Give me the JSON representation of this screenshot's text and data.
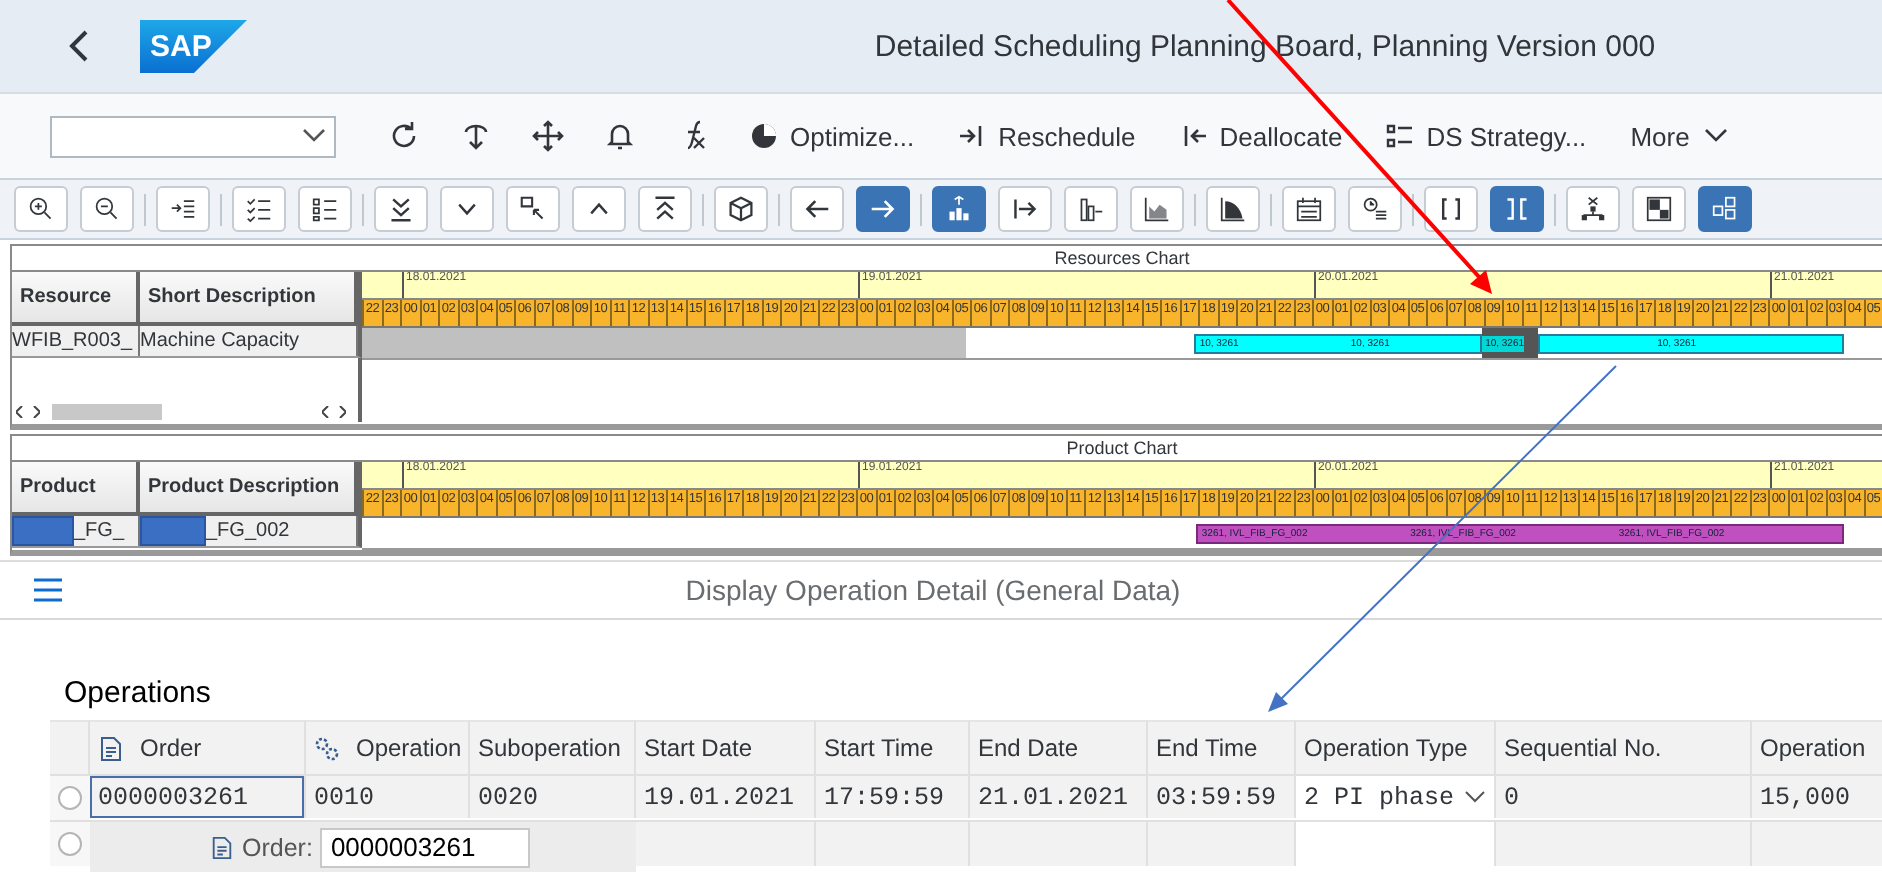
{
  "header": {
    "logo": "SAP",
    "title": "Detailed Scheduling Planning Board, Planning Version 000"
  },
  "toolbar": {
    "icons": [
      {
        "kind": "refresh"
      },
      {
        "kind": "pin"
      },
      {
        "kind": "move"
      },
      {
        "kind": "bell"
      },
      {
        "kind": "formula"
      }
    ],
    "actions": [
      {
        "kind": "optimize",
        "label": "Optimize..."
      },
      {
        "kind": "reschedule",
        "label": "Reschedule"
      },
      {
        "kind": "deallocate",
        "label": "Deallocate"
      },
      {
        "kind": "strategy",
        "label": "DS Strategy..."
      },
      {
        "kind": "more",
        "label": "More"
      }
    ]
  },
  "icon_toolbar": {
    "groups": [
      {
        "buttons": [
          {
            "kind": "zoom-in",
            "selected": false
          },
          {
            "kind": "zoom-out",
            "selected": false
          }
        ]
      },
      {
        "buttons": [
          {
            "kind": "indent",
            "selected": false
          }
        ]
      },
      {
        "buttons": [
          {
            "kind": "checklist",
            "selected": false
          },
          {
            "kind": "list",
            "selected": false
          }
        ]
      },
      {
        "buttons": [
          {
            "kind": "double-down",
            "selected": false
          },
          {
            "kind": "down",
            "selected": false
          },
          {
            "kind": "corner",
            "selected": false
          },
          {
            "kind": "up",
            "selected": false
          },
          {
            "kind": "double-up",
            "selected": false
          }
        ]
      },
      {
        "buttons": [
          {
            "kind": "cube",
            "selected": false
          }
        ]
      },
      {
        "buttons": [
          {
            "kind": "left",
            "selected": false
          },
          {
            "kind": "right",
            "selected": true
          }
        ]
      },
      {
        "buttons": [
          {
            "kind": "hierarchy",
            "selected": true
          },
          {
            "kind": "arrow-bar",
            "selected": false
          },
          {
            "kind": "bar-chart",
            "selected": false
          },
          {
            "kind": "area-chart",
            "selected": false
          }
        ]
      },
      {
        "buttons": [
          {
            "kind": "curve",
            "selected": false
          }
        ]
      },
      {
        "buttons": [
          {
            "kind": "calendar",
            "selected": false
          },
          {
            "kind": "clock-list",
            "selected": false
          }
        ]
      },
      {
        "buttons": [
          {
            "kind": "brackets",
            "selected": false
          },
          {
            "kind": "reverse-brackets",
            "selected": true
          }
        ]
      },
      {
        "buttons": [
          {
            "kind": "tree",
            "selected": false
          },
          {
            "kind": "squares",
            "selected": false
          },
          {
            "kind": "grid",
            "selected": true
          }
        ]
      }
    ]
  },
  "resources_chart": {
    "title": "Resources Chart",
    "columns": [
      "Resource",
      "Short Description"
    ],
    "days": [
      {
        "hours": [
          {
            "label": "22",
            "kind": "idle"
          },
          {
            "label": "23",
            "kind": "idle"
          }
        ]
      },
      {
        "date": "18.01.2021",
        "hours": [
          {
            "label": "00",
            "kind": "idle"
          },
          {
            "label": "01",
            "kind": "idle"
          },
          {
            "label": "02",
            "kind": "idle"
          },
          {
            "label": "03",
            "kind": "idle"
          },
          {
            "label": "04",
            "kind": "idle"
          },
          {
            "label": "05",
            "kind": "idle"
          },
          {
            "label": "06",
            "kind": "idle"
          },
          {
            "label": "07",
            "kind": "idle"
          },
          {
            "label": "08",
            "kind": "idle"
          },
          {
            "label": "09",
            "kind": "idle"
          },
          {
            "label": "10",
            "kind": "idle"
          },
          {
            "label": "11",
            "kind": "idle"
          },
          {
            "label": "12",
            "kind": "idle"
          },
          {
            "label": "13",
            "kind": "idle"
          },
          {
            "label": "14",
            "kind": "idle"
          },
          {
            "label": "15",
            "kind": "idle"
          },
          {
            "label": "16",
            "kind": "idle"
          },
          {
            "label": "17",
            "kind": "idle"
          },
          {
            "label": "18",
            "kind": "idle"
          },
          {
            "label": "19",
            "kind": "idle"
          },
          {
            "label": "20",
            "kind": "idle"
          },
          {
            "label": "21",
            "kind": "idle"
          },
          {
            "label": "22",
            "kind": "idle"
          },
          {
            "label": "23",
            "kind": "idle"
          }
        ]
      },
      {
        "date": "19.01.2021",
        "hours": [
          {
            "label": "00",
            "kind": "idle"
          },
          {
            "label": "01",
            "kind": "idle"
          },
          {
            "label": "02",
            "kind": "idle"
          },
          {
            "label": "03",
            "kind": "idle"
          },
          {
            "label": "04",
            "kind": "idle"
          },
          {
            "label": "05",
            "kind": "idle"
          },
          {
            "label": "06"
          },
          {
            "label": "07"
          },
          {
            "label": "08"
          },
          {
            "label": "09"
          },
          {
            "label": "10"
          },
          {
            "label": "11"
          },
          {
            "label": "12"
          },
          {
            "label": "13"
          },
          {
            "label": "14"
          },
          {
            "label": "15"
          },
          {
            "label": "16"
          },
          {
            "label": "17"
          },
          {
            "label": "18",
            "kind": "operation",
            "bar_label": "10, 3261"
          },
          {
            "label": "19",
            "kind": "operation"
          },
          {
            "label": "20",
            "kind": "operation"
          },
          {
            "label": "21",
            "kind": "operation"
          },
          {
            "label": "22",
            "kind": "operation"
          },
          {
            "label": "23",
            "kind": "operation"
          }
        ]
      },
      {
        "date": "20.01.2021",
        "hours": [
          {
            "label": "00",
            "kind": "operation"
          },
          {
            "label": "01",
            "kind": "operation"
          },
          {
            "label": "02",
            "kind": "operation",
            "bar_label": "10, 3261"
          },
          {
            "label": "03",
            "kind": "operation"
          },
          {
            "label": "04",
            "kind": "operation"
          },
          {
            "label": "05",
            "kind": "operation"
          },
          {
            "label": "06",
            "kind": "operation"
          },
          {
            "label": "07",
            "kind": "operation"
          },
          {
            "label": "08",
            "kind": "operation"
          },
          {
            "label": "09",
            "kind": "marker",
            "bar_label": "10, 3261"
          },
          {
            "label": "10",
            "kind": "marker"
          },
          {
            "label": "11",
            "kind": "marker"
          },
          {
            "label": "12",
            "kind": "operation"
          },
          {
            "label": "13",
            "kind": "operation"
          },
          {
            "label": "14",
            "kind": "operation"
          },
          {
            "label": "15",
            "kind": "operation"
          },
          {
            "label": "16",
            "kind": "operation"
          },
          {
            "label": "17",
            "kind": "operation"
          },
          {
            "label": "18",
            "kind": "operation",
            "bar_label": "10, 3261"
          },
          {
            "label": "19",
            "kind": "operation"
          },
          {
            "label": "20",
            "kind": "operation"
          },
          {
            "label": "21",
            "kind": "operation"
          },
          {
            "label": "22",
            "kind": "operation"
          },
          {
            "label": "23",
            "kind": "operation"
          }
        ]
      },
      {
        "date": "21.01.2021",
        "hours": [
          {
            "label": "00",
            "kind": "operation"
          },
          {
            "label": "01",
            "kind": "operation"
          },
          {
            "label": "02",
            "kind": "operation"
          },
          {
            "label": "03",
            "kind": "operation"
          },
          {
            "label": "04"
          },
          {
            "label": "05"
          }
        ]
      }
    ],
    "rows": [
      {
        "cells": [
          "WFIB_R003_",
          "Machine Capacity"
        ],
        "redacted": false
      }
    ],
    "scrollbar": true
  },
  "product_chart": {
    "title": "Product Chart",
    "columns": [
      "Product",
      "Product Description"
    ],
    "days": [
      {
        "hours": [
          {
            "label": "22"
          },
          {
            "label": "23"
          }
        ]
      },
      {
        "date": "18.01.2021",
        "hours": [
          {
            "label": "00"
          },
          {
            "label": "01"
          },
          {
            "label": "02"
          },
          {
            "label": "03"
          },
          {
            "label": "04"
          },
          {
            "label": "05"
          },
          {
            "label": "06"
          },
          {
            "label": "07"
          },
          {
            "label": "08"
          },
          {
            "label": "09"
          },
          {
            "label": "10"
          },
          {
            "label": "11"
          },
          {
            "label": "12"
          },
          {
            "label": "13"
          },
          {
            "label": "14"
          },
          {
            "label": "15"
          },
          {
            "label": "16"
          },
          {
            "label": "17"
          },
          {
            "label": "18"
          },
          {
            "label": "19"
          },
          {
            "label": "20"
          },
          {
            "label": "21"
          },
          {
            "label": "22"
          },
          {
            "label": "23"
          }
        ]
      },
      {
        "date": "19.01.2021",
        "hours": [
          {
            "label": "00"
          },
          {
            "label": "01"
          },
          {
            "label": "02"
          },
          {
            "label": "03"
          },
          {
            "label": "04"
          },
          {
            "label": "05"
          },
          {
            "label": "06"
          },
          {
            "label": "07"
          },
          {
            "label": "08"
          },
          {
            "label": "09"
          },
          {
            "label": "10"
          },
          {
            "label": "11"
          },
          {
            "label": "12"
          },
          {
            "label": "13"
          },
          {
            "label": "14"
          },
          {
            "label": "15"
          },
          {
            "label": "16"
          },
          {
            "label": "17"
          },
          {
            "label": "18",
            "kind": "product",
            "bar_label": "3261, IVL_FIB_FG_002"
          },
          {
            "label": "19",
            "kind": "product"
          },
          {
            "label": "20",
            "kind": "product"
          },
          {
            "label": "21",
            "kind": "product"
          },
          {
            "label": "22",
            "kind": "product"
          },
          {
            "label": "23",
            "kind": "product"
          }
        ]
      },
      {
        "date": "20.01.2021",
        "hours": [
          {
            "label": "00",
            "kind": "product"
          },
          {
            "label": "01",
            "kind": "product"
          },
          {
            "label": "02",
            "kind": "product"
          },
          {
            "label": "03",
            "kind": "product"
          },
          {
            "label": "04",
            "kind": "product"
          },
          {
            "label": "05",
            "kind": "product",
            "bar_label": "3261, IVL_FIB_FG_002"
          },
          {
            "label": "06",
            "kind": "product"
          },
          {
            "label": "07",
            "kind": "product"
          },
          {
            "label": "08",
            "kind": "product"
          },
          {
            "label": "09",
            "kind": "product"
          },
          {
            "label": "10",
            "kind": "product"
          },
          {
            "label": "11",
            "kind": "product"
          },
          {
            "label": "12",
            "kind": "product"
          },
          {
            "label": "13",
            "kind": "product"
          },
          {
            "label": "14",
            "kind": "product"
          },
          {
            "label": "15",
            "kind": "product"
          },
          {
            "label": "16",
            "kind": "product",
            "bar_label": "3261, IVL_FIB_FG_002"
          },
          {
            "label": "17",
            "kind": "product"
          },
          {
            "label": "18",
            "kind": "product"
          },
          {
            "label": "19",
            "kind": "product"
          },
          {
            "label": "20",
            "kind": "product"
          },
          {
            "label": "21",
            "kind": "product"
          },
          {
            "label": "22",
            "kind": "product"
          },
          {
            "label": "23",
            "kind": "product"
          }
        ]
      },
      {
        "date": "21.01.2021",
        "hours": [
          {
            "label": "00",
            "kind": "product"
          },
          {
            "label": "01",
            "kind": "product"
          },
          {
            "label": "02",
            "kind": "product"
          },
          {
            "label": "03",
            "kind": "product"
          },
          {
            "label": "04"
          },
          {
            "label": "05"
          }
        ]
      }
    ],
    "rows": [
      {
        "cells": [
          "_FG_",
          "_FG_002"
        ],
        "redacted": true
      }
    ],
    "scrollbar": false
  },
  "detail": {
    "title": "Display Operation Detail (General Data)",
    "section": "Operations",
    "columns": [
      {
        "kind": "order",
        "label": "Order"
      },
      {
        "kind": "operation",
        "label": "Operation"
      },
      {
        "kind": "plain",
        "label": "Suboperation"
      },
      {
        "kind": "plain",
        "label": "Start Date"
      },
      {
        "kind": "plain",
        "label": "Start Time"
      },
      {
        "kind": "plain",
        "label": "End Date"
      },
      {
        "kind": "plain",
        "label": "End Time"
      },
      {
        "kind": "plain",
        "label": "Operation Type"
      },
      {
        "kind": "plain",
        "label": "Sequential No."
      },
      {
        "kind": "plain",
        "label": "Operation"
      }
    ],
    "rows": [
      {
        "selected": false,
        "cells": [
          {
            "kind": "focused",
            "value": "0000003261"
          },
          {
            "kind": "text",
            "value": "0010"
          },
          {
            "kind": "text",
            "value": "0020"
          },
          {
            "kind": "text",
            "value": "19.01.2021"
          },
          {
            "kind": "text",
            "value": "17:59:59"
          },
          {
            "kind": "text",
            "value": "21.01.2021"
          },
          {
            "kind": "text",
            "value": "03:59:59"
          },
          {
            "kind": "dropdown",
            "value": "2 PI phase"
          },
          {
            "kind": "text",
            "value": "0"
          },
          {
            "kind": "text",
            "value": "15,000"
          }
        ]
      },
      {
        "selected": false,
        "cells": []
      }
    ],
    "order_field": {
      "label": "Order:",
      "value": "0000003261"
    }
  }
}
